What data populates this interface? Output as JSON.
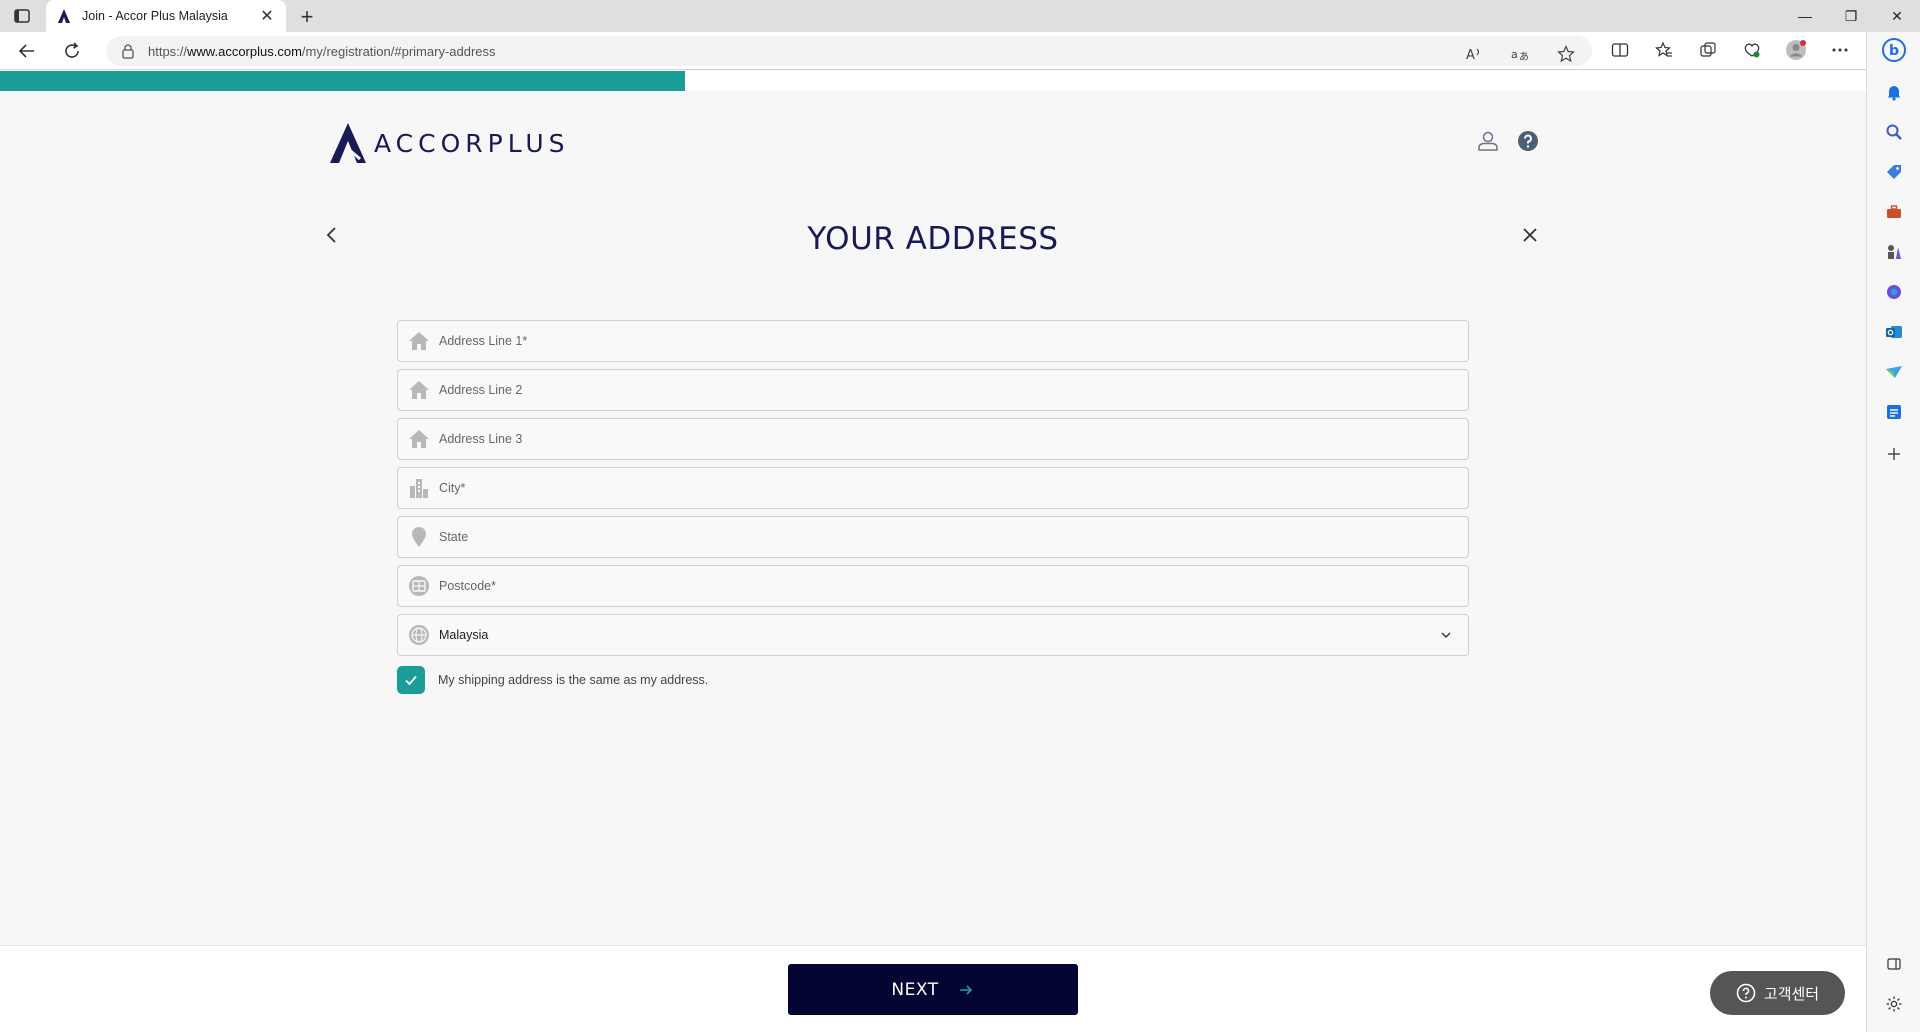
{
  "browser": {
    "tab_title": "Join - Accor Plus Malaysia",
    "url_prefix": "https://",
    "url_domain": "www.accorplus.com",
    "url_path": "/my/registration/#primary-address",
    "tab_close": "✕",
    "new_tab": "+",
    "window_controls": {
      "minimize": "—",
      "restore": "❐",
      "close": "✕"
    }
  },
  "page": {
    "progress_fraction": 0.367,
    "logo_text": "ACCORPLUS",
    "title": "YOUR ADDRESS",
    "fields": [
      {
        "placeholder": "Address Line 1*",
        "icon": "house-icon"
      },
      {
        "placeholder": "Address Line 2",
        "icon": "house-icon"
      },
      {
        "placeholder": "Address Line 3",
        "icon": "house-icon"
      },
      {
        "placeholder": "City*",
        "icon": "city-buildings-icon"
      },
      {
        "placeholder": "State",
        "icon": "location-pin-icon"
      },
      {
        "placeholder": "Postcode*",
        "icon": "postcode-icon"
      }
    ],
    "country": {
      "value": "Malaysia",
      "icon": "globe-icon"
    },
    "shipping_checkbox": {
      "checked": true,
      "label": "My shipping address is the same as my address."
    },
    "next_label": "NEXT",
    "help_label": "고객센터"
  },
  "colors": {
    "accent": "#1a9e97",
    "brand_navy": "#171a55",
    "button_dark": "#050533",
    "help_bg": "#555555"
  }
}
